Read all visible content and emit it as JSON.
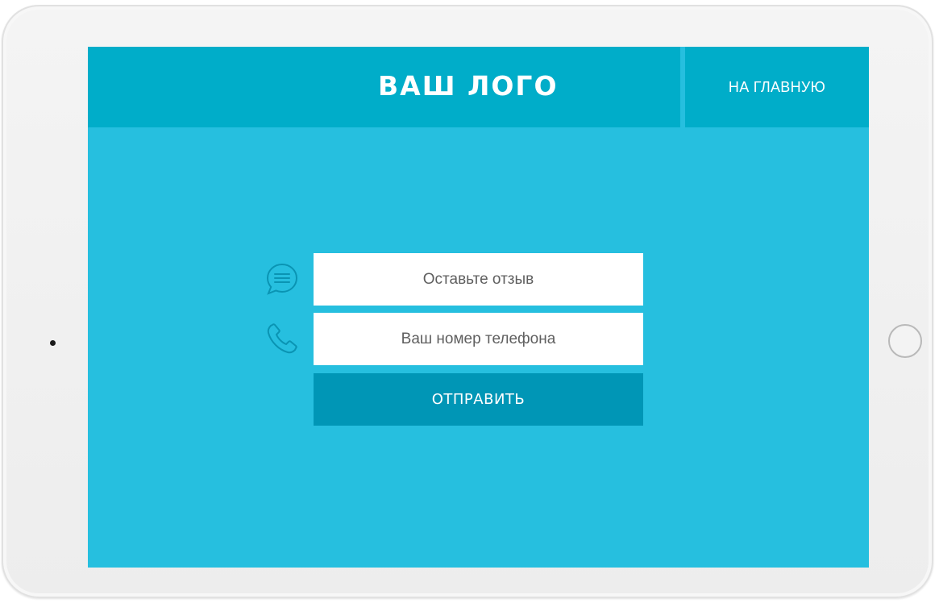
{
  "header": {
    "logo": "ВАШ ЛОГО",
    "nav_home": "НА ГЛАВНУЮ"
  },
  "form": {
    "review_placeholder": "Оставьте отзыв",
    "phone_placeholder": "Ваш номер телефона",
    "submit_label": "ОТПРАВИТЬ"
  },
  "icons": {
    "review": "comment-icon",
    "phone": "phone-icon"
  },
  "colors": {
    "screen_bg": "#26bfdf",
    "header_bg": "#00adc9",
    "button_bg": "#0096b6",
    "icon_stroke": "#0a94b3"
  }
}
